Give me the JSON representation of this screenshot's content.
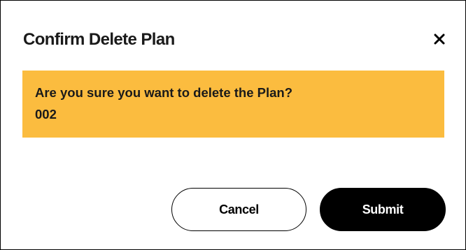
{
  "dialog": {
    "title": "Confirm Delete Plan",
    "close_icon": "close-icon",
    "message_line1": "Are you sure you want to delete the Plan?",
    "message_line2": "002",
    "cancel_label": "Cancel",
    "submit_label": "Submit"
  },
  "colors": {
    "warning_bg": "#fbbc3f",
    "primary_button_bg": "#000000",
    "primary_button_text": "#ffffff"
  }
}
